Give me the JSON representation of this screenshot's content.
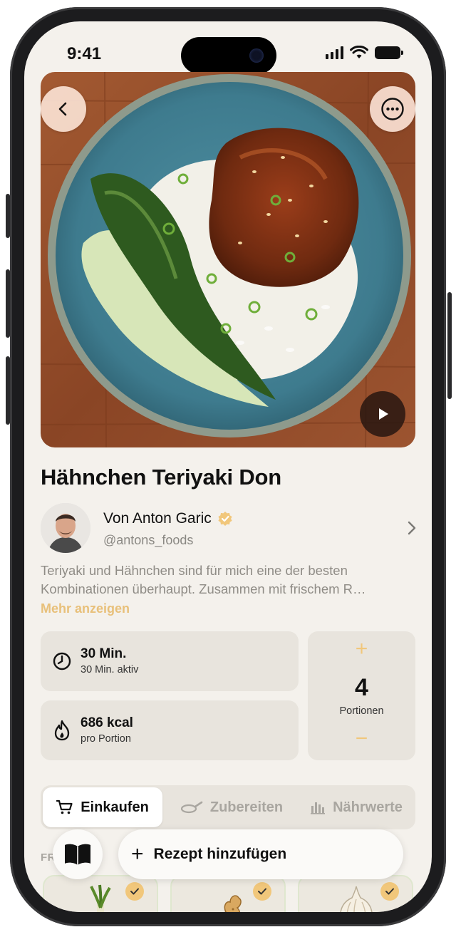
{
  "status_bar": {
    "time": "9:41"
  },
  "recipe": {
    "title": "Hähnchen Teriyaki Don",
    "author": {
      "name": "Von Anton Garic",
      "handle": "@antons_foods"
    },
    "description_line1": "Teriyaki und Hähnchen sind für mich eine der besten",
    "description_line2": "Kombinationen überhaupt. Zusammen mit frischem R…",
    "more_label": "Mehr anzeigen"
  },
  "stats": {
    "time": {
      "main": "30 Min.",
      "sub": "30 Min. aktiv",
      "icon": "clock-icon"
    },
    "energy": {
      "main": "686 kcal",
      "sub": "pro Portion",
      "icon": "flame-icon"
    },
    "servings": {
      "count": "4",
      "label": "Portionen",
      "plus": "+",
      "minus": "−"
    }
  },
  "tabs": [
    {
      "label": "Einkaufen",
      "icon": "cart-icon",
      "active": true
    },
    {
      "label": "Zubereiten",
      "icon": "pan-icon",
      "active": false
    },
    {
      "label": "Nährwerte",
      "icon": "bar-chart-icon",
      "active": false
    }
  ],
  "section_label": "FRISCHE & ",
  "ingredients": [
    {
      "icon": "leek-icon",
      "checked": true
    },
    {
      "icon": "ginger-icon",
      "checked": true
    },
    {
      "icon": "garlic-icon",
      "checked": true
    }
  ],
  "actions": {
    "add_recipe": "Rezept hinzufügen",
    "book_icon": "book-icon"
  },
  "colors": {
    "accent": "#f1c77b",
    "background": "#f4f1ec",
    "card": "#e8e4dd"
  }
}
